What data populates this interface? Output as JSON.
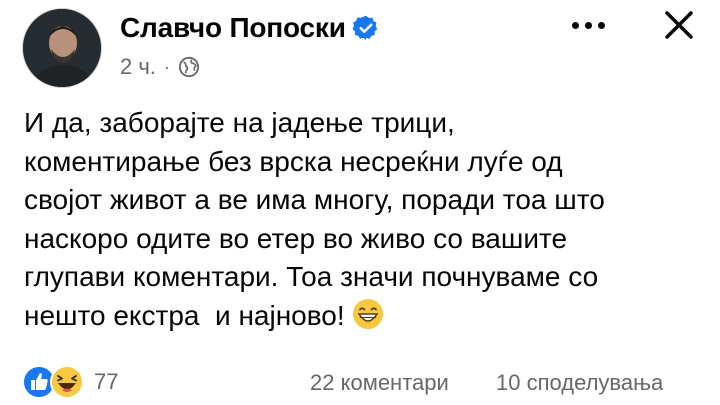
{
  "post": {
    "author": "Славчо Попоски",
    "time": "2 ч.",
    "separator": "·",
    "text_lines": [
      "И да, заборајте на јадење трици,",
      "коментирање без врска несреќни луѓе од",
      "својот живот а ве има многу, поради тоа што",
      "наскоро одите во етер во живо со вашите",
      "глупави коментари. Тоа значи почнуваме со",
      "нешто екстра  и најново!"
    ],
    "emoji": "grinning-face-with-smiling-eyes"
  },
  "icons": {
    "verified": "verified-badge-icon",
    "audience": "globe-icon",
    "more": "more-options-icon",
    "close": "close-icon",
    "like": "like-reaction-icon",
    "haha": "haha-reaction-icon"
  },
  "engagement": {
    "reaction_count": "77",
    "comments": "22 коментари",
    "shares": "10 споделувања"
  },
  "colors": {
    "accent": "#1877f2",
    "secondary_text": "#65676b",
    "primary_text": "#050505",
    "haha_yellow": "#f7c942"
  }
}
